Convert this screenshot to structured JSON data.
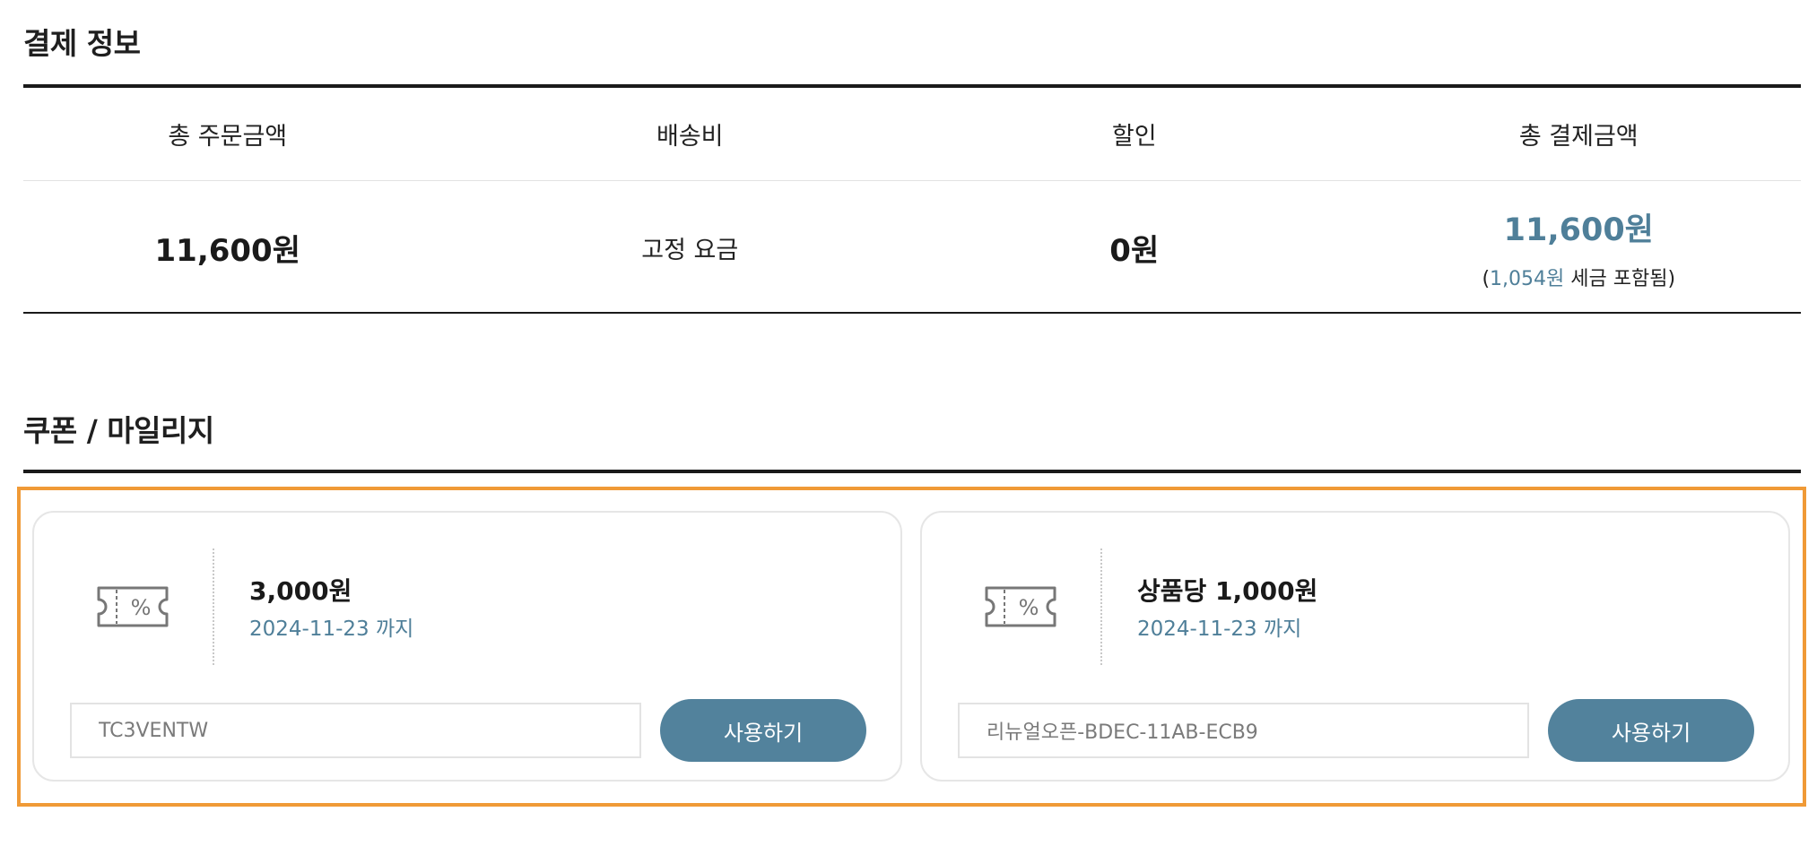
{
  "payment": {
    "title": "결제 정보",
    "headers": [
      "총 주문금액",
      "배송비",
      "할인",
      "총 결제금액"
    ],
    "order_total": "11,600원",
    "shipping": "고정 요금",
    "discount": "0원",
    "grand_total": "11,600원",
    "tax_open": "(",
    "tax_amount": "1,054원",
    "tax_suffix": " 세금 포함됨)"
  },
  "coupon": {
    "title": "쿠폰 / 마일리지",
    "cards": [
      {
        "amount": "3,000원",
        "expiry": "2024-11-23 까지",
        "code": "TC3VENTW",
        "button_label": "사용하기",
        "icon": "coupon-ticket-icon"
      },
      {
        "amount": "상품당 1,000원",
        "expiry": "2024-11-23 까지",
        "code": "리뉴얼오픈-BDEC-11AB-ECB9",
        "button_label": "사용하기",
        "icon": "coupon-ticket-icon"
      }
    ]
  },
  "colors": {
    "accent": "#4f7f99",
    "button": "#52829c",
    "highlight_border": "#f09a36",
    "rule": "#1a1a1a"
  }
}
